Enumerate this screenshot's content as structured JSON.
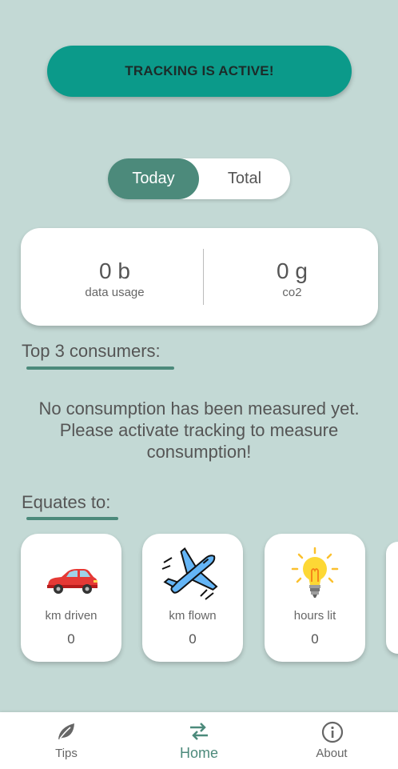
{
  "tracking_button": {
    "label": "TRACKING IS ACTIVE!"
  },
  "toggle": {
    "today": "Today",
    "total": "Total",
    "selected": "Today"
  },
  "stats": [
    {
      "value": "0 b",
      "label": "data usage"
    },
    {
      "value": "0 g",
      "label": "co2"
    }
  ],
  "top_consumers": {
    "title": "Top 3 consumers:",
    "message": "No consumption has been measured yet. Please activate tracking to measure consumption!"
  },
  "equates": {
    "title": "Equates to:",
    "cards": [
      {
        "icon": "car-icon",
        "label": "km driven",
        "value": "0"
      },
      {
        "icon": "airplane-icon",
        "label": "km flown",
        "value": "0"
      },
      {
        "icon": "lightbulb-icon",
        "label": "hours lit",
        "value": "0"
      }
    ]
  },
  "nav": [
    {
      "icon": "leaf-icon",
      "label": "Tips"
    },
    {
      "icon": "swap-arrows-icon",
      "label": "Home",
      "active": true
    },
    {
      "icon": "info-icon",
      "label": "About"
    }
  ],
  "colors": {
    "accent": "#0b9a8a",
    "primary": "#4c8a7b",
    "background": "#c3d9d5"
  }
}
